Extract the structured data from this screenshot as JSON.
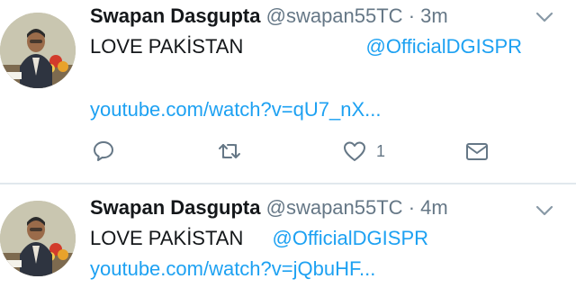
{
  "tweets": [
    {
      "author": "Swapan Dasgupta",
      "handle": "@swapan55TC",
      "separator": "·",
      "time": "3m",
      "text": "LOVE PAKİSTAN",
      "mention": "@OfficialDGISPR",
      "link": "youtube.com/watch?v=qU7_nX...",
      "like_count": "1",
      "icons": [
        "reply-icon",
        "retweet-icon",
        "like-icon",
        "direct-message-icon",
        "chevron-down-icon"
      ]
    },
    {
      "author": "Swapan Dasgupta",
      "handle": "@swapan55TC",
      "separator": "·",
      "time": "4m",
      "text": "LOVE PAKİSTAN",
      "mention": "@OfficialDGISPR",
      "link": "youtube.com/watch?v=jQbuHF..."
    }
  ],
  "colors": {
    "link": "#1da1f2",
    "secondary_text": "#657786",
    "divider": "#e1e8ed"
  }
}
